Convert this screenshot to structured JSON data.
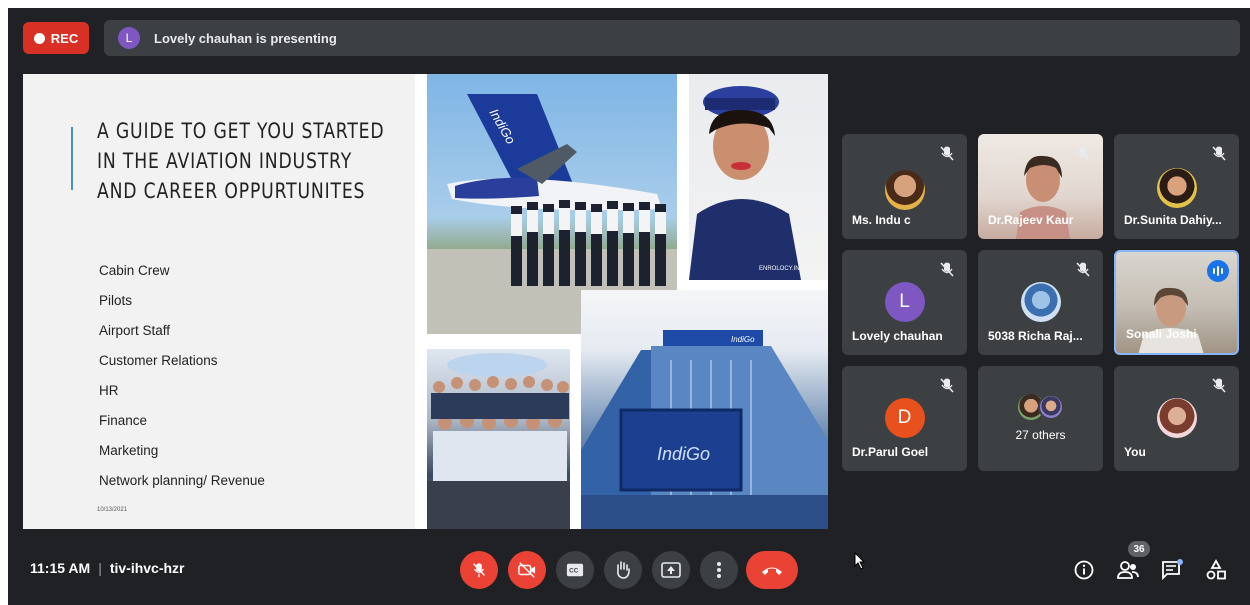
{
  "recording": {
    "label": "REC"
  },
  "presenter_bar": {
    "avatar_letter": "L",
    "text": "Lovely chauhan is presenting"
  },
  "slide": {
    "title_lines": [
      "A GUIDE TO GET YOU STARTED",
      "IN THE AVIATION INDUSTRY",
      "AND CAREER OPPURTUNITES"
    ],
    "items": [
      "Cabin Crew",
      "Pilots",
      "Airport Staff",
      "Customer Relations",
      "HR",
      "Finance",
      "Marketing",
      "Network planning/ Revenue"
    ],
    "date": "10/13/2021",
    "photo_texts": {
      "plane_brand": "IndiGo",
      "watermark": "ENROLOCY.IN",
      "building_sign": "IndiGo",
      "building_top_sign": "IndiGo"
    }
  },
  "participants": [
    {
      "name": "Ms. Indu c",
      "mic": "muted",
      "avatar": "photo"
    },
    {
      "name": "Dr.Rajeev Kaur",
      "mic": "muted",
      "avatar": "video"
    },
    {
      "name": "Dr.Sunita Dahiy...",
      "mic": "muted",
      "avatar": "photo"
    },
    {
      "name": "Lovely chauhan",
      "mic": "muted",
      "avatar": "letter",
      "letter": "L",
      "color": "#7e57c2"
    },
    {
      "name": "5038 Richa Raj...",
      "mic": "muted",
      "avatar": "photo"
    },
    {
      "name": "Sonali Joshi",
      "mic": "speaking",
      "avatar": "video"
    },
    {
      "name": "Dr.Parul Goel",
      "mic": "muted",
      "avatar": "letter",
      "letter": "D",
      "color": "#e8501e"
    },
    {
      "name": "27 others",
      "avatar": "group"
    },
    {
      "name": "You",
      "mic": "muted",
      "avatar": "photo"
    }
  ],
  "bottom_bar": {
    "time": "11:15 AM",
    "meeting_code": "tiv-ihvc-hzr",
    "participant_count": "36"
  },
  "controls": {
    "mic": "muted-mic-icon",
    "camera": "camera-off-icon",
    "captions": "closed-captions-icon",
    "raise_hand": "raise-hand-icon",
    "present": "present-screen-icon",
    "more": "more-options-icon",
    "leave": "leave-call-icon"
  },
  "colors": {
    "background": "#202124",
    "tile": "#3c4043",
    "danger": "#ea4335",
    "accent": "#8ab4f8"
  }
}
